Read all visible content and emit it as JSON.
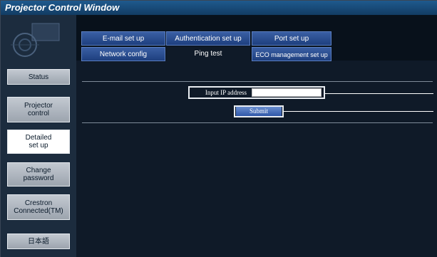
{
  "window": {
    "title": "Projector Control Window"
  },
  "sidebar": {
    "items": [
      {
        "label": "Status",
        "name": "sidebar-item-status",
        "active": false
      },
      {
        "label": "Projector\ncontrol",
        "name": "sidebar-item-projector-control",
        "active": false
      },
      {
        "label": "Detailed\nset up",
        "name": "sidebar-item-detailed-set-up",
        "active": true
      },
      {
        "label": "Change\npassword",
        "name": "sidebar-item-change-password",
        "active": false
      },
      {
        "label": "Crestron\nConnected(TM)",
        "name": "sidebar-item-crestron-connected",
        "active": false
      },
      {
        "label": "日本語",
        "name": "sidebar-item-japanese",
        "active": false
      }
    ]
  },
  "tabs": {
    "row1": [
      "E-mail set up",
      "Authentication set up",
      "Port set up"
    ],
    "row2": [
      "Network config",
      "Ping test",
      "ECO management set up"
    ],
    "selected": "Ping test"
  },
  "ping_test": {
    "input_label": "Input IP address",
    "input_value": "",
    "submit_label": "Submit"
  },
  "colors": {
    "accent": "#2f57a8",
    "background": "#0f1a28",
    "titlebar": "#1f5a8e"
  }
}
